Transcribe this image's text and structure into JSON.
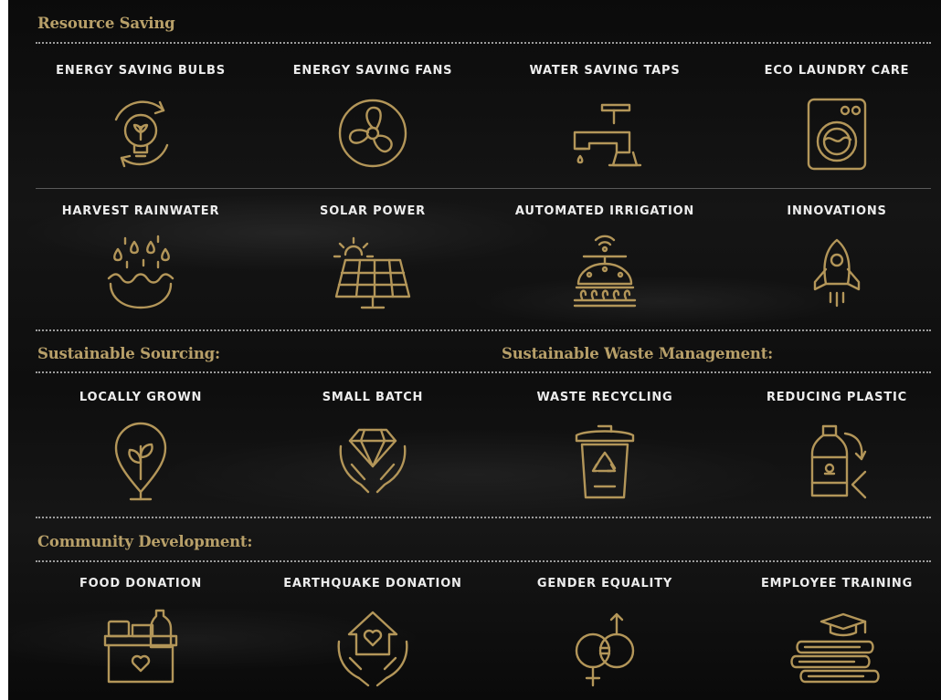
{
  "sections": {
    "resource_saving": "Resource Saving",
    "sustainable_sourcing": "Sustainable Sourcing:",
    "waste_management": "Sustainable Waste Management:",
    "community_development": "Community Development:"
  },
  "resource_items": [
    {
      "label": "ENERGY SAVING BULBS",
      "icon": "recycle-bulb-icon"
    },
    {
      "label": "ENERGY SAVING FANS",
      "icon": "fan-icon"
    },
    {
      "label": "WATER SAVING TAPS",
      "icon": "faucet-icon"
    },
    {
      "label": "ECO LAUNDRY CARE",
      "icon": "washing-machine-icon"
    },
    {
      "label": "HARVEST RAINWATER",
      "icon": "rainwater-icon"
    },
    {
      "label": "SOLAR POWER",
      "icon": "solar-panel-icon"
    },
    {
      "label": "AUTOMATED IRRIGATION",
      "icon": "irrigation-icon"
    },
    {
      "label": "INNOVATIONS",
      "icon": "rocket-icon"
    }
  ],
  "sourcing_items": [
    {
      "label": "LOCALLY GROWN",
      "icon": "sprout-pin-icon"
    },
    {
      "label": "SMALL BATCH",
      "icon": "diamond-hands-icon"
    }
  ],
  "waste_items": [
    {
      "label": "WASTE RECYCLING",
      "icon": "recycle-bin-icon"
    },
    {
      "label": "REDUCING PLASTIC",
      "icon": "plastic-bottle-icon"
    }
  ],
  "community_items": [
    {
      "label": "FOOD DONATION",
      "icon": "food-box-icon"
    },
    {
      "label": "EARTHQUAKE DONATION",
      "icon": "house-hands-icon"
    },
    {
      "label": "GENDER EQUALITY",
      "icon": "gender-equality-icon"
    },
    {
      "label": "EMPLOYEE TRAINING",
      "icon": "books-graduation-icon"
    }
  ],
  "colors": {
    "gold": "#b39659",
    "heading": "#b8a069",
    "label": "#ededed",
    "background": "#111111"
  }
}
